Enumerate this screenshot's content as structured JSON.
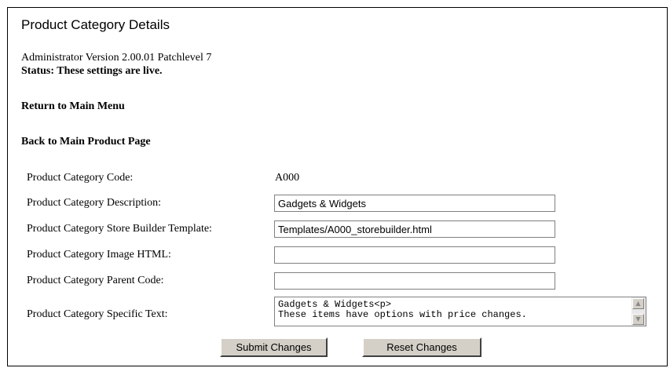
{
  "page": {
    "title": "Product Category Details",
    "version_text": "Administrator Version 2.00.01 Patchlevel 7",
    "status_text": "Status: These settings are live."
  },
  "nav": {
    "return_main_menu": "Return to Main Menu",
    "back_main_product": "Back to Main Product Page"
  },
  "form": {
    "code": {
      "label": "Product Category Code:",
      "value": "A000"
    },
    "description": {
      "label": "Product Category Description:",
      "value": "Gadgets & Widgets"
    },
    "template": {
      "label": "Product Category Store Builder Template:",
      "value": "Templates/A000_storebuilder.html"
    },
    "image_html": {
      "label": "Product Category Image HTML:",
      "value": ""
    },
    "parent_code": {
      "label": "Product Category Parent Code:",
      "value": ""
    },
    "specific_text": {
      "label": "Product Category Specific Text:",
      "value": "Gadgets & Widgets<p>\nThese items have options with price changes."
    }
  },
  "buttons": {
    "submit": "Submit Changes",
    "reset": "Reset Changes"
  },
  "icons": {
    "scroll_up": "scroll-up-arrow",
    "scroll_down": "scroll-down-arrow"
  }
}
